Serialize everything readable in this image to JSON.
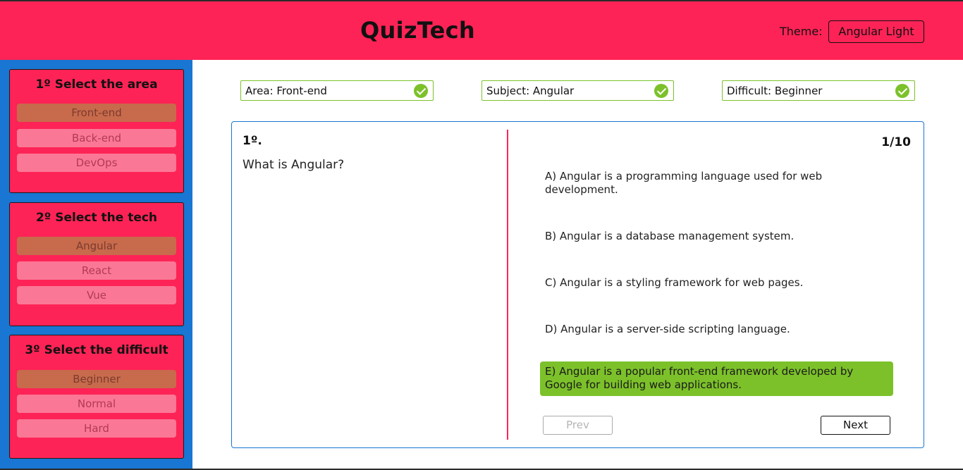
{
  "header": {
    "title": "QuizTech",
    "theme_label": "Theme:",
    "theme_value": "Angular Light"
  },
  "sidebar": {
    "panels": [
      {
        "title": "1º Select the area",
        "options": [
          "Front-end",
          "Back-end",
          "DevOps"
        ],
        "selected": "Front-end"
      },
      {
        "title": "2º Select the tech",
        "options": [
          "Angular",
          "React",
          "Vue"
        ],
        "selected": "Angular"
      },
      {
        "title": "3º Select the difficult",
        "options": [
          "Beginner",
          "Normal",
          "Hard"
        ],
        "selected": "Beginner"
      }
    ]
  },
  "selection_chips": [
    {
      "label": "Area: Front-end",
      "icon": "check-circle-icon"
    },
    {
      "label": "Subject: Angular",
      "icon": "check-circle-icon"
    },
    {
      "label": "Difficult: Beginner",
      "icon": "check-circle-icon"
    }
  ],
  "quiz": {
    "question_number": "1º.",
    "question": "What is Angular?",
    "progress": "1/10",
    "answers": [
      "A) Angular is a programming language used for web development.",
      "B) Angular is a database management system.",
      "C) Angular is a styling framework for web pages.",
      "D) Angular is a server-side scripting language.",
      "E) Angular is a popular front-end framework developed by Google for building web applications."
    ],
    "correct_answer_index": 4,
    "prev_label": "Prev",
    "next_label": "Next"
  },
  "colors": {
    "brand": "#fe2356",
    "sidebar": "#1976d2",
    "option": "#fa7896",
    "option_selected": "#c76b4c",
    "success": "#7cc12a"
  }
}
